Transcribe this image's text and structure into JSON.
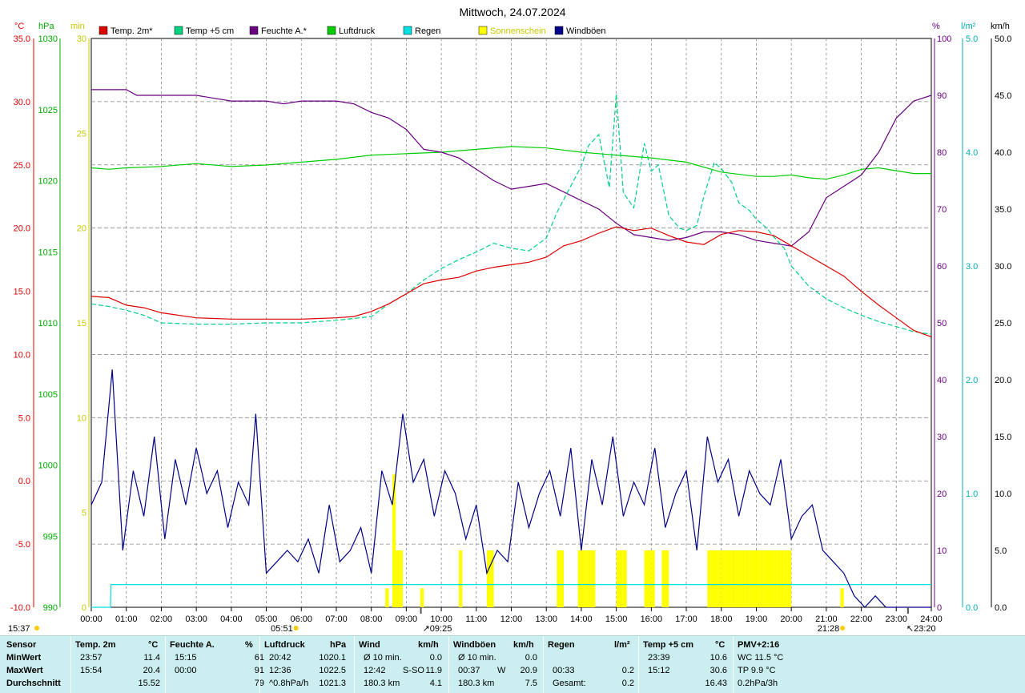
{
  "title": "Mittwoch, 24.07.2024",
  "colors": {
    "temp2m": "#dd0000",
    "temp5cm": "#00d080",
    "humidity": "#6a0080",
    "pressure": "#00cc00",
    "rain": "#00e0e0",
    "sunshine": "#ffff00",
    "gust": "#000088",
    "grid": "#888888",
    "statsBg": "#cbeff0"
  },
  "legend": [
    {
      "label": "Temp. 2m*",
      "color": "#dd0000"
    },
    {
      "label": "Temp +5 cm",
      "color": "#00d080"
    },
    {
      "label": "Feuchte A.*",
      "color": "#6a0080"
    },
    {
      "label": "Luftdruck",
      "color": "#00cc00"
    },
    {
      "label": "Regen",
      "color": "#00e0e0"
    },
    {
      "label": "Sonnenschein",
      "color": "#ffff00"
    },
    {
      "label": "Windböen",
      "color": "#000088"
    }
  ],
  "axes": {
    "left_units": [
      "°C",
      "hPa",
      "min"
    ],
    "right_units": [
      "%",
      "l/m²",
      "km/h"
    ],
    "temp_ticks": [
      "35.0",
      "30.0",
      "25.0",
      "20.0",
      "15.0",
      "10.0",
      "5.0",
      "0.0",
      "-5.0",
      "-10.0"
    ],
    "pressure_ticks": [
      "1030",
      "1025",
      "1020",
      "1015",
      "1010",
      "1005",
      "1000",
      "995",
      "990"
    ],
    "sun_ticks": [
      "30",
      "25",
      "20",
      "15",
      "10",
      "5",
      "0"
    ],
    "humidity_ticks": [
      "100",
      "90",
      "80",
      "70",
      "60",
      "50",
      "40",
      "30",
      "20",
      "10",
      "0"
    ],
    "rain_ticks": [
      "5.0",
      "4.0",
      "3.0",
      "2.0",
      "1.0",
      "0.0"
    ],
    "wind_ticks": [
      "50.0",
      "45.0",
      "40.0",
      "35.0",
      "30.0",
      "25.0",
      "20.0",
      "15.0",
      "10.0",
      "5.0",
      "0.0"
    ],
    "time_ticks": [
      "00:00",
      "01:00",
      "02:00",
      "03:00",
      "04:00",
      "05:00",
      "06:00",
      "07:00",
      "08:00",
      "09:00",
      "10:00",
      "11:00",
      "12:00",
      "13:00",
      "14:00",
      "15:00",
      "16:00",
      "17:00",
      "18:00",
      "19:00",
      "20:00",
      "21:00",
      "22:00",
      "23:00",
      "24:00"
    ]
  },
  "astro": {
    "sunrise": "05:51",
    "sunset": "21:28",
    "moonrise": "23:20",
    "moonset": "09:25",
    "now": "15:37"
  },
  "chart_data": {
    "type": "line",
    "x_unit": "hours",
    "x_range": [
      0,
      24
    ],
    "series": [
      {
        "name": "Temp. 2m*",
        "axis": "temp",
        "ylim": [
          -10,
          35
        ],
        "x": [
          0,
          0.5,
          1,
          1.5,
          2,
          3,
          4,
          5,
          6,
          7,
          7.5,
          8,
          8.5,
          9,
          9.5,
          10,
          10.5,
          11,
          11.5,
          12,
          12.5,
          13,
          13.5,
          14,
          14.5,
          15,
          15.5,
          16,
          16.5,
          17,
          17.5,
          18,
          18.5,
          19,
          19.5,
          20,
          20.5,
          21,
          21.5,
          22,
          22.5,
          23,
          23.5,
          24
        ],
        "y": [
          14.6,
          14.5,
          13.9,
          13.7,
          13.3,
          12.9,
          12.8,
          12.8,
          12.8,
          12.9,
          13.0,
          13.4,
          14.0,
          14.8,
          15.6,
          15.9,
          16.1,
          16.6,
          16.9,
          17.1,
          17.3,
          17.7,
          18.6,
          19.0,
          19.6,
          20.1,
          19.8,
          20.0,
          19.4,
          18.9,
          18.7,
          19.5,
          19.8,
          19.7,
          19.4,
          18.6,
          17.8,
          17.0,
          16.2,
          15.0,
          13.9,
          12.9,
          11.9,
          11.4
        ]
      },
      {
        "name": "Temp +5 cm",
        "axis": "temp",
        "ylim": [
          -10,
          35
        ],
        "x": [
          0,
          0.5,
          1,
          1.5,
          2,
          3,
          4,
          5,
          6,
          7,
          8,
          8.5,
          9,
          9.5,
          10,
          10.5,
          11,
          11.5,
          12,
          12.5,
          13,
          13.3,
          13.6,
          14,
          14.2,
          14.5,
          14.8,
          15,
          15.2,
          15.5,
          15.8,
          16,
          16.2,
          16.5,
          16.8,
          17,
          17.3,
          17.5,
          17.8,
          18,
          18.3,
          18.5,
          18.8,
          19,
          19.3,
          19.5,
          19.8,
          20,
          20.5,
          21,
          21.5,
          22,
          22.5,
          23,
          23.5,
          24
        ],
        "y": [
          14.0,
          13.8,
          13.5,
          13.1,
          12.5,
          12.4,
          12.4,
          12.5,
          12.5,
          12.7,
          13.0,
          14.0,
          14.8,
          15.9,
          16.8,
          17.5,
          18.1,
          18.8,
          18.4,
          18.2,
          19.2,
          21.2,
          22.8,
          24.9,
          26.5,
          27.4,
          23.2,
          30.6,
          22.8,
          21.6,
          26.7,
          24.5,
          25.0,
          21.0,
          20.0,
          19.8,
          20.2,
          22.5,
          25.2,
          24.7,
          23.6,
          22.0,
          21.4,
          20.7,
          20.0,
          19.3,
          18.4,
          17.0,
          15.4,
          14.4,
          13.7,
          13.1,
          12.6,
          12.2,
          11.8,
          11.6
        ]
      },
      {
        "name": "Feuchte A.*",
        "axis": "humidity",
        "ylim": [
          0,
          100
        ],
        "x": [
          0,
          0.5,
          1,
          1.3,
          2,
          3,
          4,
          5,
          5.5,
          6,
          7,
          7.5,
          8,
          8.5,
          9,
          9.5,
          10,
          10.5,
          11,
          11.5,
          12,
          12.5,
          13,
          13.5,
          14,
          14.5,
          15,
          15.5,
          16,
          16.5,
          17,
          17.5,
          18,
          18.5,
          19,
          19.5,
          20,
          20.5,
          21,
          21.5,
          22,
          22.5,
          23,
          23.5,
          24
        ],
        "y": [
          91,
          91,
          91,
          90,
          90,
          90,
          89,
          89,
          88.5,
          89,
          89,
          88.5,
          87,
          86,
          84,
          80.5,
          80,
          79,
          77,
          75,
          73.5,
          74,
          74.5,
          73,
          71.5,
          70,
          67.5,
          65.5,
          65,
          64.5,
          65,
          66,
          66,
          65.5,
          64.5,
          64,
          63.5,
          66,
          72,
          74,
          76,
          80,
          86,
          89,
          90
        ]
      },
      {
        "name": "Luftdruck",
        "axis": "pressure",
        "ylim": [
          990,
          1030
        ],
        "x": [
          0,
          0.5,
          1,
          2,
          3,
          4,
          5,
          6,
          7,
          8,
          9,
          10,
          11,
          12,
          13,
          14,
          15,
          16,
          17,
          18,
          19,
          19.5,
          20,
          20.5,
          21,
          21.5,
          22,
          22.5,
          23,
          23.5,
          24
        ],
        "y": [
          1020.9,
          1020.8,
          1020.9,
          1021.0,
          1021.2,
          1021.0,
          1021.1,
          1021.3,
          1021.5,
          1021.8,
          1021.9,
          1022.0,
          1022.2,
          1022.4,
          1022.3,
          1022.0,
          1021.8,
          1021.6,
          1021.3,
          1020.6,
          1020.3,
          1020.3,
          1020.4,
          1020.2,
          1020.1,
          1020.4,
          1020.8,
          1020.9,
          1020.7,
          1020.5,
          1020.5
        ]
      },
      {
        "name": "Regen",
        "axis": "rain",
        "ylim": [
          0,
          5
        ],
        "x": [
          0,
          0.55,
          0.56,
          24
        ],
        "y": [
          0.0,
          0.0,
          0.2,
          0.2
        ]
      },
      {
        "name": "Sonnenschein",
        "axis": "sun",
        "ylim": [
          0,
          30
        ],
        "render": "bars",
        "x": [
          8.4,
          8.6,
          8.7,
          8.8,
          9.4,
          10.5,
          11.3,
          11.4,
          13.3,
          13.4,
          13.9,
          14.0,
          14.1,
          14.2,
          14.3,
          15.0,
          15.1,
          15.2,
          15.8,
          15.9,
          16.0,
          16.3,
          16.4,
          17.6,
          17.7,
          17.8,
          17.9,
          18.0,
          18.1,
          18.2,
          18.3,
          18.4,
          18.5,
          18.6,
          18.7,
          18.8,
          18.9,
          19.0,
          19.1,
          19.2,
          19.3,
          19.4,
          19.5,
          19.6,
          19.7,
          19.8,
          19.9,
          21.4
        ],
        "y": [
          1,
          7,
          3,
          3,
          1,
          3,
          3,
          3,
          3,
          3,
          3,
          3,
          3,
          3,
          3,
          3,
          3,
          3,
          3,
          3,
          3,
          3,
          3,
          3,
          3,
          3,
          3,
          3,
          3,
          3,
          3,
          3,
          3,
          3,
          3,
          3,
          3,
          3,
          3,
          3,
          3,
          3,
          3,
          3,
          3,
          3,
          3,
          1
        ]
      },
      {
        "name": "Windböen",
        "axis": "wind",
        "ylim": [
          0,
          50
        ],
        "x": [
          0,
          0.3,
          0.6,
          0.9,
          1.2,
          1.5,
          1.8,
          2.1,
          2.4,
          2.7,
          3.0,
          3.3,
          3.6,
          3.9,
          4.2,
          4.5,
          4.7,
          5.0,
          5.3,
          5.6,
          5.9,
          6.2,
          6.5,
          6.8,
          7.1,
          7.4,
          7.7,
          8.0,
          8.3,
          8.6,
          8.9,
          9.2,
          9.5,
          9.8,
          10.1,
          10.4,
          10.7,
          11.0,
          11.3,
          11.6,
          11.9,
          12.2,
          12.5,
          12.8,
          13.1,
          13.4,
          13.7,
          14.0,
          14.3,
          14.6,
          14.9,
          15.2,
          15.5,
          15.8,
          16.1,
          16.4,
          16.7,
          17.0,
          17.3,
          17.6,
          17.9,
          18.2,
          18.5,
          18.8,
          19.1,
          19.4,
          19.7,
          20.0,
          20.3,
          20.6,
          20.9,
          21.2,
          21.5,
          21.8,
          22.1,
          22.4,
          22.7,
          23.0,
          23.5,
          24
        ],
        "y": [
          9,
          11,
          20.9,
          5,
          12,
          8,
          15,
          6,
          13,
          9,
          14,
          10,
          12,
          7,
          11,
          9,
          17,
          3,
          4,
          5,
          4,
          6,
          3,
          9,
          4,
          5,
          7,
          3,
          12,
          9,
          17,
          11,
          13,
          8,
          12,
          10,
          6,
          9,
          3,
          5,
          4,
          11,
          7,
          10,
          12,
          8,
          14,
          5,
          13,
          9,
          15,
          8,
          11,
          9,
          14,
          7,
          10,
          12,
          5,
          15,
          11,
          13,
          8,
          12,
          10,
          9,
          13,
          6,
          8,
          9,
          5,
          4,
          3,
          1,
          0,
          1,
          0,
          0,
          0,
          0
        ]
      }
    ]
  },
  "stats": {
    "headers": {
      "sensor": "Sensor",
      "temp": "Temp. 2m",
      "temp_u": "°C",
      "hum": "Feuchte A.",
      "hum_u": "%",
      "press": "Luftdruck",
      "press_u": "hPa",
      "wind": "Wind",
      "wind_u": "km/h",
      "gust": "Windböen",
      "gust_u": "km/h",
      "rain": "Regen",
      "rain_u": "l/m²",
      "t5": "Temp +5 cm",
      "t5_u": "°C",
      "pmv": "PMV+2:16"
    },
    "rows": [
      {
        "label": "MinWert",
        "temp_t": "23:57",
        "temp_v": "11.4",
        "hum_t": "15:15",
        "hum_v": "61",
        "press_t": "20:42",
        "press_v": "1020.1",
        "wind_a": "Ø 10 min.",
        "wind_b": "",
        "wind_v": "0.0",
        "gust_a": "Ø 10 min.",
        "gust_b": "",
        "gust_v": "0.0",
        "rain_t": "",
        "rain_v": "",
        "t5_t": "23:39",
        "t5_v": "10.6",
        "pmv": "WC 11.5 °C"
      },
      {
        "label": "MaxWert",
        "temp_t": "15:54",
        "temp_v": "20.4",
        "hum_t": "00:00",
        "hum_v": "91",
        "press_t": "12:36",
        "press_v": "1022.5",
        "wind_a": "12:42",
        "wind_b": "S-SO",
        "wind_v": "11.9",
        "gust_a": "00:37",
        "gust_b": "W",
        "gust_v": "20.9",
        "rain_t": "00:33",
        "rain_v": "0.2",
        "t5_t": "15:12",
        "t5_v": "30.6",
        "pmv": "TP 9.9 °C"
      },
      {
        "label": "Durchschnitt",
        "temp_t": "",
        "temp_v": "15.52",
        "hum_t": "",
        "hum_v": "79",
        "press_t": "^0.8hPa/h",
        "press_v": "1021.3",
        "wind_a": "180.3 km",
        "wind_b": "",
        "wind_v": "4.1",
        "gust_a": "180.3 km",
        "gust_b": "",
        "gust_v": "7.5",
        "rain_t": "Gesamt:",
        "rain_v": "0.2",
        "t5_t": "",
        "t5_v": "16.43",
        "pmv": "0.2hPa/3h"
      }
    ]
  }
}
